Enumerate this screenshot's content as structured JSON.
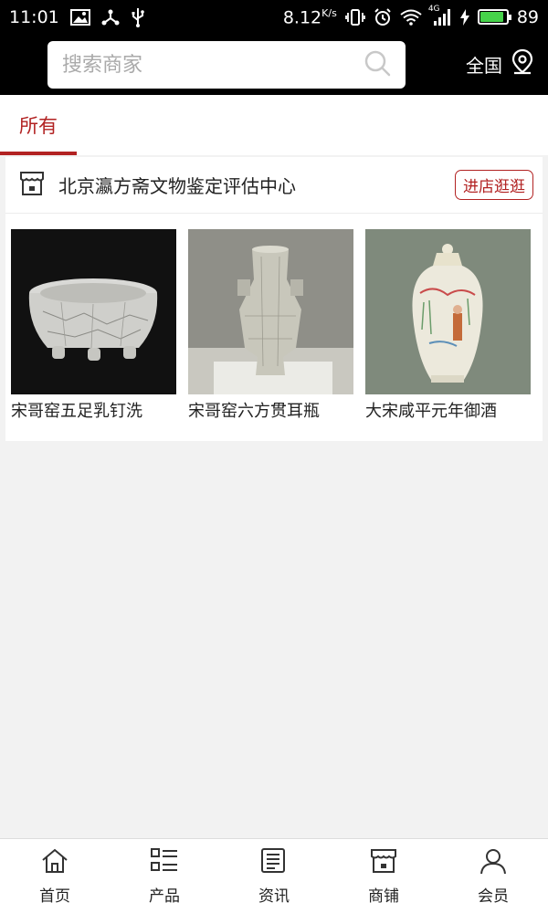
{
  "status_bar": {
    "time": "11:01",
    "speed": "8.12",
    "speed_unit": "K/s",
    "network": "4G",
    "battery": "89",
    "battery_color": "#46d34a"
  },
  "search": {
    "placeholder": "搜索商家"
  },
  "region": {
    "label": "全国"
  },
  "tabs": [
    {
      "label": "所有",
      "active": true
    }
  ],
  "store": {
    "name": "北京瀛方斋文物鉴定评估中心",
    "visit_label": "进店逛逛",
    "products": [
      {
        "name": "宋哥窑五足乳钉洗"
      },
      {
        "name": "宋哥窑六方贯耳瓶"
      },
      {
        "name": "大宋咸平元年御酒"
      }
    ]
  },
  "bottom_nav": [
    {
      "label": "首页",
      "icon": "home-icon"
    },
    {
      "label": "产品",
      "icon": "list-icon"
    },
    {
      "label": "资讯",
      "icon": "news-icon"
    },
    {
      "label": "商铺",
      "icon": "shop-icon"
    },
    {
      "label": "会员",
      "icon": "user-icon"
    }
  ],
  "colors": {
    "accent": "#b22222",
    "header_bg": "#000000"
  }
}
